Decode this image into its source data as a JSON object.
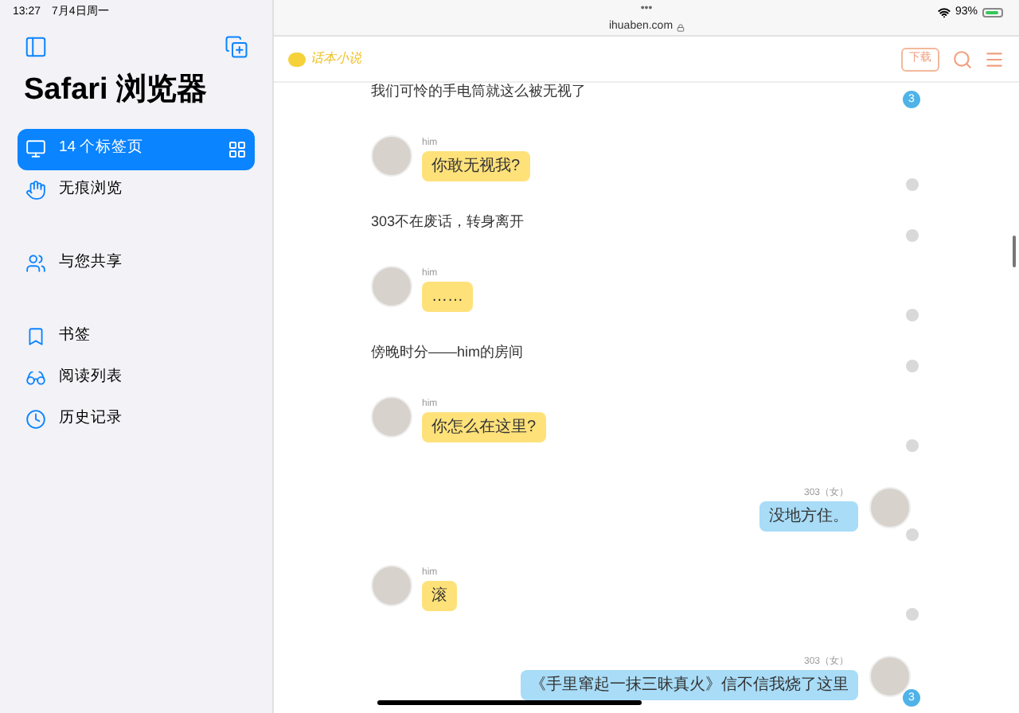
{
  "status_bar": {
    "time": "13:27",
    "date": "7月4日周一",
    "battery": "93%"
  },
  "sidebar": {
    "title": "Safari 浏览器",
    "sections": [
      [
        {
          "label": "14 个标签页",
          "selected": true
        },
        {
          "label": "无痕浏览",
          "selected": false
        }
      ],
      [
        {
          "label": "与您共享",
          "selected": false
        }
      ],
      [
        {
          "label": "书签",
          "selected": false
        },
        {
          "label": "阅读列表",
          "selected": false
        },
        {
          "label": "历史记录",
          "selected": false
        }
      ]
    ]
  },
  "address_bar": {
    "url": "ihuaben.com",
    "dots": "•••"
  },
  "site_header": {
    "logo": "话本小说",
    "download": "下载"
  },
  "chat": [
    {
      "kind": "narration",
      "text": "我们可怜的手电筒就这么被无视了",
      "comments": "3"
    },
    {
      "kind": "left",
      "name": "him",
      "text": "你敢无视我?"
    },
    {
      "kind": "narration",
      "text": "303不在废话，转身离开"
    },
    {
      "kind": "left",
      "name": "him",
      "text": "……"
    },
    {
      "kind": "narration",
      "text": "傍晚时分——him的房间"
    },
    {
      "kind": "left",
      "name": "him",
      "text": "你怎么在这里?"
    },
    {
      "kind": "right",
      "name": "303（女）",
      "text": "没地方住。"
    },
    {
      "kind": "left",
      "name": "him",
      "text": "滚"
    },
    {
      "kind": "right",
      "name": "303（女）",
      "text": "《手里窜起一抹三昧真火》信不信我烧了这里",
      "comments": "3"
    }
  ]
}
